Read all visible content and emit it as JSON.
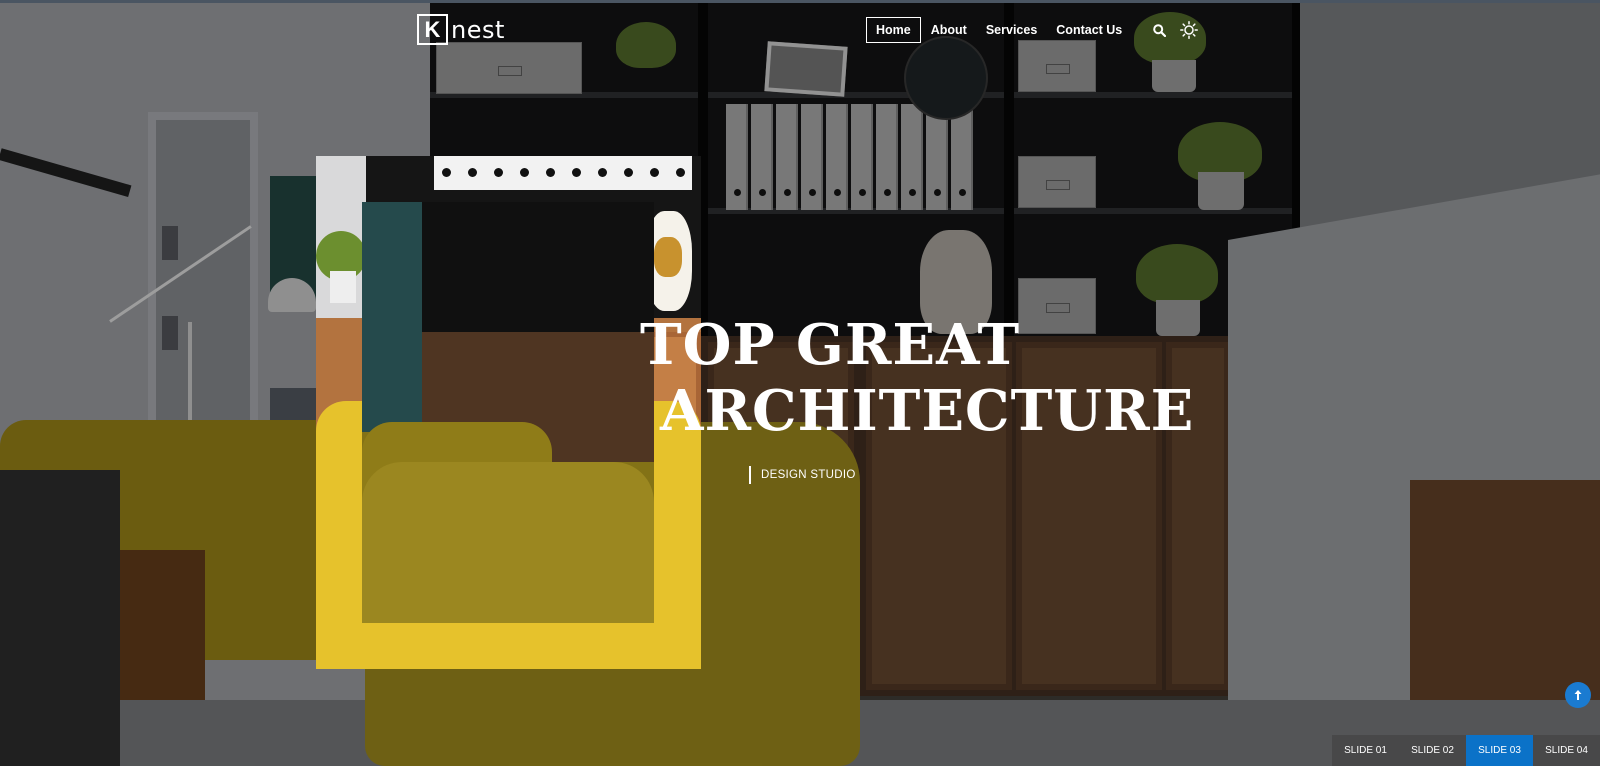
{
  "brand": {
    "logo_letter": "K",
    "logo_text": "nest"
  },
  "nav": {
    "items": [
      {
        "label": "Home",
        "active": true
      },
      {
        "label": "About",
        "active": false
      },
      {
        "label": "Services",
        "active": false
      },
      {
        "label": "Contact Us",
        "active": false
      }
    ],
    "icons": [
      "search-icon",
      "sun-icon"
    ]
  },
  "hero": {
    "title_line1": "TOP GREAT",
    "title_line2": "ARCHITECTURE",
    "subtitle": "DESIGN STUDIO"
  },
  "slides": {
    "tabs": [
      {
        "label": "SLIDE 01",
        "active": false
      },
      {
        "label": "SLIDE 02",
        "active": false
      },
      {
        "label": "SLIDE 03",
        "active": true
      },
      {
        "label": "SLIDE 04",
        "active": false
      }
    ]
  },
  "scroll_top": {
    "icon": "arrow-up-icon"
  },
  "colors": {
    "accent": "#0b72c8",
    "text": "#ffffff",
    "highlight_frame": "#e6c22c"
  }
}
